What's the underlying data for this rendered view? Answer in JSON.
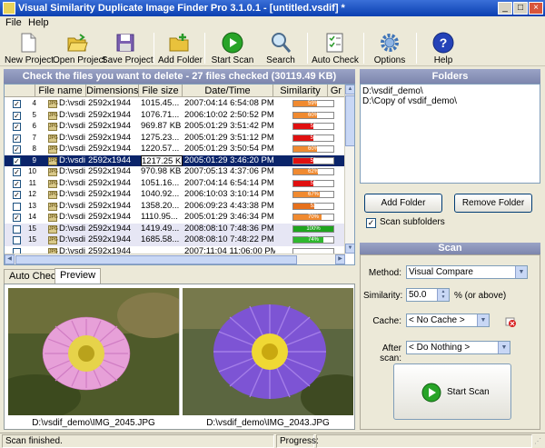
{
  "window": {
    "title": "Visual Similarity Duplicate Image Finder Pro 3.1.0.1 - [untitled.vsdif] *"
  },
  "menu": [
    "File",
    "Help"
  ],
  "toolbar": {
    "new_project": "New Project",
    "open_project": "Open Project",
    "save_project": "Save Project",
    "add_folder": "Add Folder",
    "start_scan": "Start Scan",
    "search": "Search",
    "auto_check": "Auto Check",
    "options": "Options",
    "help": "Help"
  },
  "results": {
    "header": "Check the files you want to delete - 27 files checked (30119.49 KB)",
    "columns": [
      "File name",
      "Dimensions",
      "File size",
      "Date/Time",
      "Similarity",
      "Gr"
    ],
    "rows": [
      {
        "num": "4",
        "checked": true,
        "name": "D:\\vsdi",
        "dim": "2592x1944",
        "size": "1015.45...",
        "date": "2007:04:14 6:54:08 PM",
        "sim": "59%",
        "pct": 0.59,
        "color": "#f08a30"
      },
      {
        "num": "5",
        "checked": true,
        "name": "D:\\vsdi",
        "dim": "2592x1944",
        "size": "1076.71...",
        "date": "2006:10:02 2:50:52 PM",
        "sim": "60%",
        "pct": 0.6,
        "color": "#f08a30"
      },
      {
        "num": "6",
        "checked": true,
        "name": "D:\\vsdi",
        "dim": "2592x1944",
        "size": "969.87 KB",
        "date": "2005:01:29 3:51:42 PM",
        "sim": "51",
        "pct": 0.51,
        "color": "#e01010"
      },
      {
        "num": "7",
        "checked": true,
        "name": "D:\\vsdi",
        "dim": "2592x1944",
        "size": "1275.23...",
        "date": "2005:01:29 3:51:12 PM",
        "sim": "50",
        "pct": 0.5,
        "color": "#e01010"
      },
      {
        "num": "8",
        "checked": true,
        "name": "D:\\vsdi",
        "dim": "2592x1944",
        "size": "1220.57...",
        "date": "2005:01:29 3:50:54 PM",
        "sim": "60%",
        "pct": 0.6,
        "color": "#f08a30"
      },
      {
        "num": "9",
        "checked": true,
        "name": "D:\\vsdi",
        "dim": "2592x1944",
        "size": "1217.25 KB",
        "date": "2005:01:29 3:46:20 PM",
        "sim": "51",
        "pct": 0.51,
        "color": "#e01010",
        "selected": true
      },
      {
        "num": "10",
        "checked": true,
        "name": "D:\\vsdi",
        "dim": "2592x1944",
        "size": "970.98 KB",
        "date": "2007:05:13 4:37:06 PM",
        "sim": "62%",
        "pct": 0.62,
        "color": "#f08a30"
      },
      {
        "num": "11",
        "checked": true,
        "name": "D:\\vsdi",
        "dim": "2592x1944",
        "size": "1051.16...",
        "date": "2007:04:14 6:54:14 PM",
        "sim": "51",
        "pct": 0.51,
        "color": "#e01010"
      },
      {
        "num": "12",
        "checked": true,
        "name": "D:\\vsdi",
        "dim": "2592x1944",
        "size": "1040.92...",
        "date": "2006:10:03 3:10:14 PM",
        "sim": "67%",
        "pct": 0.67,
        "color": "#f08a30"
      },
      {
        "num": "13",
        "checked": false,
        "name": "D:\\vsdi",
        "dim": "2592x1944",
        "size": "1358.20...",
        "date": "2006:09:23 4:43:38 PM",
        "sim": "53",
        "pct": 0.53,
        "color": "#e6701c"
      },
      {
        "num": "14",
        "checked": true,
        "name": "D:\\vsdi",
        "dim": "2592x1944",
        "size": "1110.95...",
        "date": "2005:01:29 3:46:34 PM",
        "sim": "70%",
        "pct": 0.7,
        "color": "#f08a30"
      },
      {
        "num": "15",
        "checked": false,
        "name": "D:\\vsdi",
        "dim": "2592x1944",
        "size": "1419.49...",
        "date": "2008:08:10 7:48:36 PM",
        "sim": "100%",
        "pct": 1.0,
        "color": "#1ea51e",
        "group": true
      },
      {
        "num": "15",
        "checked": false,
        "name": "D:\\vsdi",
        "dim": "2592x1944",
        "size": "1685.58...",
        "date": "2008:08:10 7:48:22 PM",
        "sim": "74%",
        "pct": 0.74,
        "color": "#2fb82f",
        "group": true
      },
      {
        "num": "",
        "checked": false,
        "name": "D:\\vsdi",
        "dim": "2592x1944",
        "size": "",
        "date": "2007:11:04 11:06:00 PM",
        "sim": "",
        "pct": 0.0,
        "color": "#f08a30"
      }
    ]
  },
  "tabs": [
    "Auto Check",
    "Preview"
  ],
  "preview": {
    "left_caption": "D:\\vsdif_demo\\IMG_2045.JPG",
    "right_caption": "D:\\vsdif_demo\\IMG_2043.JPG"
  },
  "folders": {
    "title": "Folders",
    "items": [
      "D:\\vsdif_demo\\",
      "D:\\Copy of vsdif_demo\\"
    ],
    "add_button": "Add Folder",
    "remove_button": "Remove Folder",
    "scan_subfolders": "Scan subfolders"
  },
  "scan": {
    "title": "Scan",
    "method_label": "Method:",
    "method_value": "Visual Compare",
    "similarity_label": "Similarity:",
    "similarity_value": "50.0",
    "similarity_suffix": "% (or above)",
    "cache_label": "Cache:",
    "cache_value": "< No Cache >",
    "after_label": "After scan:",
    "after_value": "< Do Nothing >",
    "start_button": "Start Scan"
  },
  "status": {
    "text": "Scan finished.",
    "progress_label": "Progress:"
  },
  "colors": {
    "accent": "#0a246a",
    "header_gradient": "#7d86ad"
  }
}
